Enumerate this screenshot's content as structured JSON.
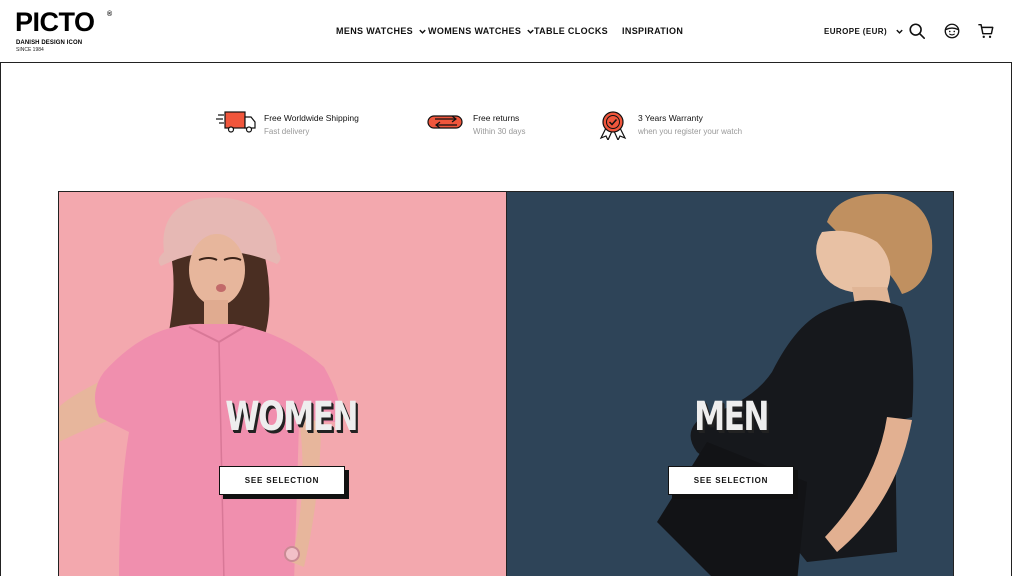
{
  "brand": {
    "name": "PICTO",
    "registered": "®",
    "tagline": "DANISH DESIGN ICON",
    "since": "SINCE 1984"
  },
  "nav": {
    "items": [
      {
        "label": "MENS WATCHES",
        "has_dropdown": true
      },
      {
        "label": "WOMENS WATCHES",
        "has_dropdown": true
      },
      {
        "label": "TABLE CLOCKS",
        "has_dropdown": false
      },
      {
        "label": "INSPIRATION",
        "has_dropdown": false
      }
    ]
  },
  "header": {
    "region_label": "EUROPE (EUR)",
    "icons": [
      "search-icon",
      "account-icon",
      "cart-icon"
    ]
  },
  "usps": [
    {
      "icon": "delivery-truck-icon",
      "title": "Free Worldwide Shipping",
      "subtitle": "Fast delivery"
    },
    {
      "icon": "returns-arrows-icon",
      "title": "Free returns",
      "subtitle": "Within 30 days"
    },
    {
      "icon": "warranty-badge-icon",
      "title": "3 Years Warranty",
      "subtitle": "when you register your watch"
    }
  ],
  "hero": {
    "women": {
      "title": "WOMEN",
      "cta": "SEE SELECTION"
    },
    "men": {
      "title": "MEN",
      "cta": "SEE SELECTION"
    }
  },
  "colors": {
    "accent": "#f0563c",
    "women_bg": "#f3a8ae",
    "men_bg": "#2e4458",
    "border": "#222222"
  }
}
